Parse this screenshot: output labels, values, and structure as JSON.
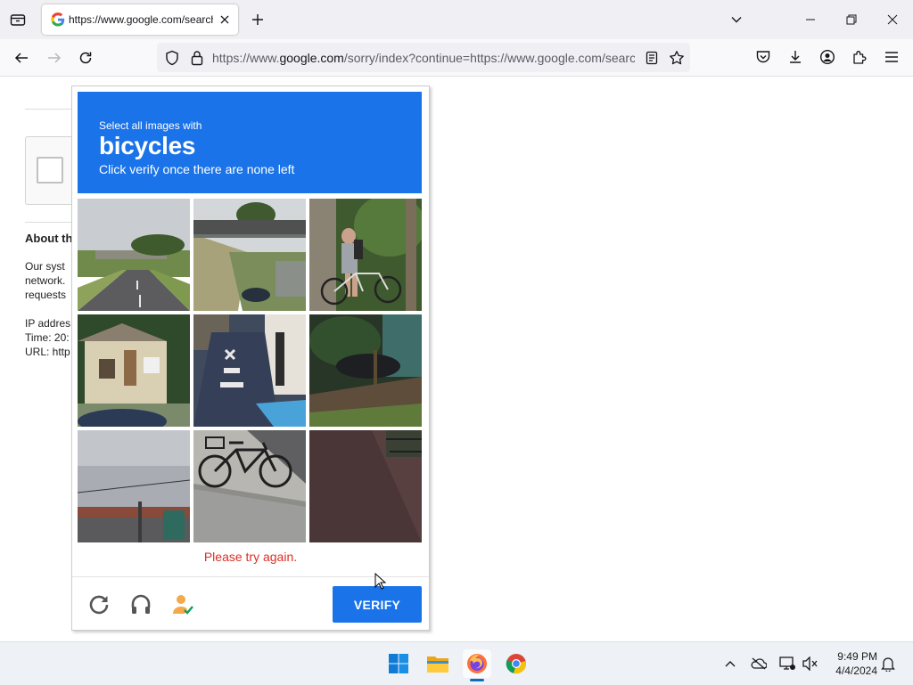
{
  "browser": {
    "tab": {
      "title": "https://www.google.com/search",
      "favicon": "google-g-icon"
    },
    "url": {
      "prefix": "https://www.",
      "host": "google.com",
      "path": "/sorry/index?continue=https://www.google.com/search"
    }
  },
  "page": {
    "about_heading": "About th",
    "lines": [
      "Our syst",
      "network.",
      "requests"
    ],
    "info": [
      "IP addres",
      "Time: 20:",
      "URL: http"
    ]
  },
  "captcha": {
    "instruction_line1": "Select all images with",
    "target_object": "bicycles",
    "instruction_line3": "Click verify once there are none left",
    "error_message": "Please try again.",
    "verify_label": "VERIFY",
    "header_color": "#1a73e8",
    "tiles": [
      {
        "description": "road under overpass"
      },
      {
        "description": "pedestrian bridge with car"
      },
      {
        "description": "person with bicycle"
      },
      {
        "description": "house with car"
      },
      {
        "description": "painted bike lane"
      },
      {
        "description": "motorcycle near fence"
      },
      {
        "description": "sky over rooftops"
      },
      {
        "description": "black bicycle on sidewalk"
      },
      {
        "description": "brick pavement"
      }
    ]
  },
  "taskbar": {
    "apps": [
      "windows-start-icon",
      "file-explorer-icon",
      "firefox-icon",
      "chrome-icon"
    ],
    "time": "9:49 PM",
    "date": "4/4/2024"
  }
}
